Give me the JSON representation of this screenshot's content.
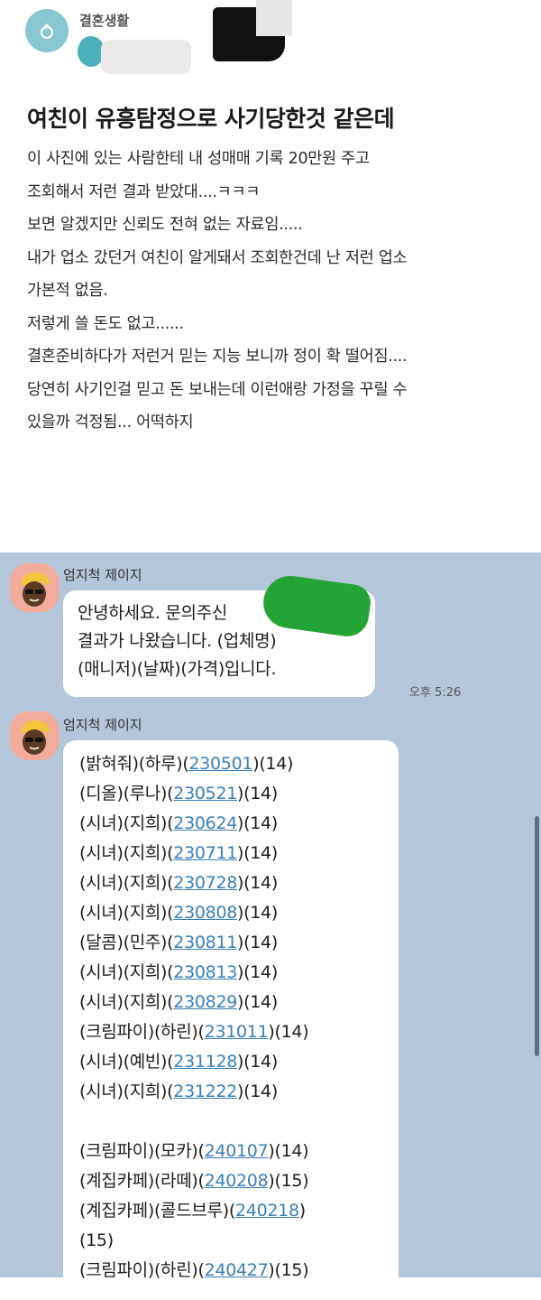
{
  "post": {
    "community": "결혼생활",
    "title": "여친이 유흥탐정으로 사기당한것 같은데",
    "lines": [
      "이 사진에 있는 사람한테 내 성매매 기록 20만원 주고",
      "조회해서 저런 결과 받았대....ㅋㅋㅋ",
      "보면 알겠지만 신뢰도 전혀 없는 자료임.....",
      "내가 업소 갔던거 여친이 알게돼서 조회한건데 난 저런 업소",
      "가본적 없음.",
      "저렇게 쓸 돈도 없고......",
      "결혼준비하다가 저런거 믿는 지능 보니까 정이 확 떨어짐....",
      "당연히 사기인걸 믿고 돈 보내는데 이런애랑 가정을 꾸릴 수",
      "있을까 걱정됨... 어떡하지"
    ]
  },
  "chat": {
    "messages": [
      {
        "sender": "엄지척 제이지",
        "lines": [
          "안녕하세요. 문의주신",
          "결과가 나왔습니다. (업체명)",
          "(매니저)(날짜)(가격)입니다."
        ],
        "time": "오후 5:26"
      },
      {
        "sender": "엄지척 제이지",
        "rows": [
          {
            "pre": "(밝혀줘)(하루)(",
            "date": "230501",
            "post": ")(14)"
          },
          {
            "pre": "(디올)(루나)(",
            "date": "230521",
            "post": ")(14)"
          },
          {
            "pre": "(시녀)(지희)(",
            "date": "230624",
            "post": ")(14)"
          },
          {
            "pre": "(시녀)(지희)(",
            "date": "230711",
            "post": ")(14)"
          },
          {
            "pre": "(시녀)(지희)(",
            "date": "230728",
            "post": ")(14)"
          },
          {
            "pre": "(시녀)(지희)(",
            "date": "230808",
            "post": ")(14)"
          },
          {
            "pre": "(달콤)(민주)(",
            "date": "230811",
            "post": ")(14)"
          },
          {
            "pre": "(시녀)(지희)(",
            "date": "230813",
            "post": ")(14)"
          },
          {
            "pre": "(시녀)(지희)(",
            "date": "230829",
            "post": ")(14)"
          },
          {
            "pre": "(크림파이)(하린)(",
            "date": "231011",
            "post": ")(14)"
          },
          {
            "pre": "(시녀)(예빈)(",
            "date": "231128",
            "post": ")(14)"
          },
          {
            "pre": "(시녀)(지희)(",
            "date": "231222",
            "post": ")(14)"
          },
          {
            "blank": true
          },
          {
            "pre": "(크림파이)(모카)(",
            "date": "240107",
            "post": ")(14)"
          },
          {
            "pre": "(계집카페)(라떼)(",
            "date": "240208",
            "post": ")(15)"
          },
          {
            "pre": "(계집카페)(콜드브루)(",
            "date": "240218",
            "post": ")"
          },
          {
            "pre": "(15)",
            "date": "",
            "post": ""
          },
          {
            "pre": "(크림파이)(하린)(",
            "date": "240427",
            "post": ")(15)"
          }
        ]
      }
    ]
  },
  "colors": {
    "chat_background": "#b4c6d9",
    "link": "#3a7fb8",
    "avatar": "#f2ab9b",
    "community_avatar": "#86c7d0"
  },
  "icons": [
    "ring-icon",
    "character-avatar-icon"
  ]
}
